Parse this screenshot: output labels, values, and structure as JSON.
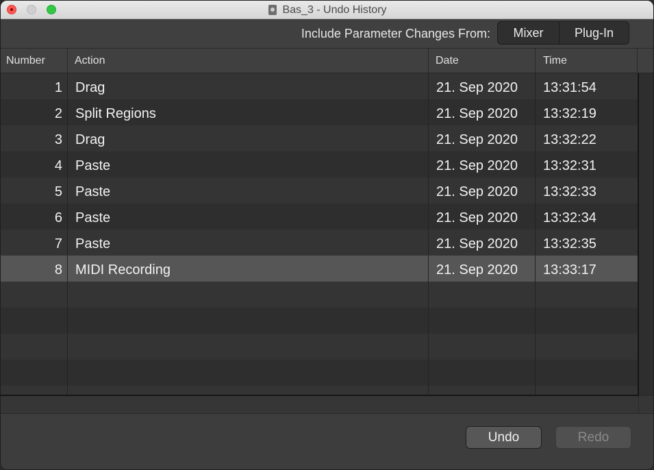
{
  "window": {
    "title": "Bas_3 - Undo History"
  },
  "toolbar": {
    "include_label": "Include Parameter Changes From:",
    "segments": [
      {
        "label": "Mixer"
      },
      {
        "label": "Plug-In"
      }
    ]
  },
  "table": {
    "headers": {
      "number": "Number",
      "action": "Action",
      "date": "Date",
      "time": "Time"
    },
    "rows": [
      {
        "number": "1",
        "action": "Drag",
        "date": "21. Sep 2020",
        "time": "13:31:54"
      },
      {
        "number": "2",
        "action": "Split Regions",
        "date": "21. Sep 2020",
        "time": "13:32:19"
      },
      {
        "number": "3",
        "action": "Drag",
        "date": "21. Sep 2020",
        "time": "13:32:22"
      },
      {
        "number": "4",
        "action": "Paste",
        "date": "21. Sep 2020",
        "time": "13:32:31"
      },
      {
        "number": "5",
        "action": "Paste",
        "date": "21. Sep 2020",
        "time": "13:32:33"
      },
      {
        "number": "6",
        "action": "Paste",
        "date": "21. Sep 2020",
        "time": "13:32:34"
      },
      {
        "number": "7",
        "action": "Paste",
        "date": "21. Sep 2020",
        "time": "13:32:35"
      },
      {
        "number": "8",
        "action": "MIDI Recording",
        "date": "21. Sep 2020",
        "time": "13:33:17"
      }
    ],
    "selected_row": "8"
  },
  "footer": {
    "undo_label": "Undo",
    "redo_label": "Redo",
    "redo_enabled": false
  },
  "icons": {
    "title_document": "logic-project-document-icon"
  },
  "colors": {
    "close": "#fc5753",
    "zoom": "#33c748",
    "selected_row": "#565656"
  }
}
